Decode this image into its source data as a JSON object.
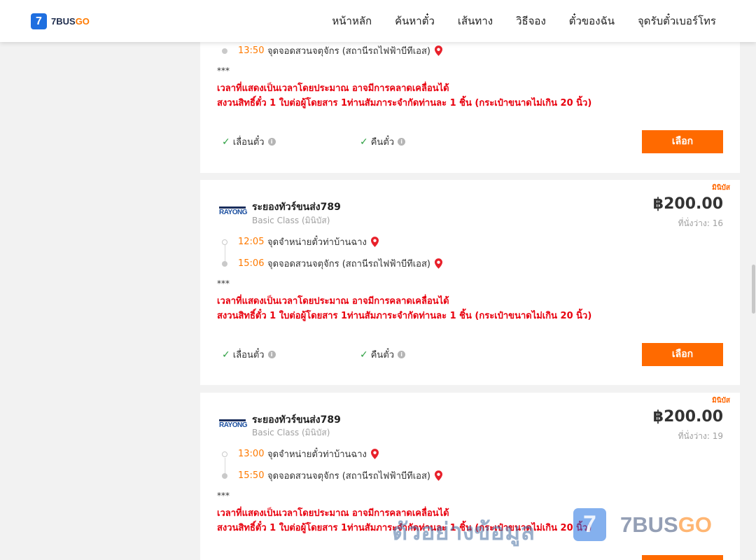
{
  "header": {
    "logo_mark": "7",
    "logo_text_a": "7BUS",
    "logo_text_b": "GO",
    "nav": [
      "หน้าหลัก",
      "ค้นหาตั๋ว",
      "เส้นทาง",
      "วิธีจอง",
      "ตั๋วของฉัน",
      "จุดรับตั๋วเบอร์โทร"
    ]
  },
  "colors": {
    "accent": "#ff6a00",
    "time": "#ff7a00",
    "warning": "#e8000e",
    "brand_blue": "#1f6fe0"
  },
  "icons": {
    "pin": "map-pin-icon",
    "check": "check-icon",
    "info": "info-icon"
  },
  "card0": {
    "arrive_time": "13:50",
    "arrive_place": "จุดจอดสวนจตุจักร (สถานีรถไฟฟ้าบีทีเอส)",
    "stars": "***",
    "note1": "เวลาที่แสดงเป็นเวลาโดยประมาณ อาจมีการคลาดเคลื่อนได้",
    "note2": "สงวนสิทธิ์ตั๋ว 1 ใบต่อผู้โดยสาร 1ท่านสัมภาระจำกัดท่านละ 1 ชิ้น (กระเป๋าขนาดไม่เกิน 20 นิ้ว)",
    "opt_reschedule": "เลื่อนตั๋ว",
    "opt_refund": "คืนตั๋ว",
    "select": "เลือก"
  },
  "card1": {
    "badge": "มินิบัส",
    "operator_logo": "RAYONG",
    "operator": "ระยองทัวร์ขนส่ง789",
    "class": "Basic Class (มินิบัส)",
    "price": "฿200.00",
    "seats": "ที่นั่งว่าง: 16",
    "depart_time": "12:05",
    "depart_place": "จุดจำหน่ายตั๋วท่าบ้านฉาง",
    "arrive_time": "15:06",
    "arrive_place": "จุดจอดสวนจตุจักร (สถานีรถไฟฟ้าบีทีเอส)",
    "stars": "***",
    "note1": "เวลาที่แสดงเป็นเวลาโดยประมาณ อาจมีการคลาดเคลื่อนได้",
    "note2": "สงวนสิทธิ์ตั๋ว 1 ใบต่อผู้โดยสาร 1ท่านสัมภาระจำกัดท่านละ 1 ชิ้น (กระเป๋าขนาดไม่เกิน 20 นิ้ว)",
    "opt_reschedule": "เลื่อนตั๋ว",
    "opt_refund": "คืนตั๋ว",
    "select": "เลือก"
  },
  "card2": {
    "badge": "มินิบัส",
    "operator_logo": "RAYONG",
    "operator": "ระยองทัวร์ขนส่ง789",
    "class": "Basic Class (มินิบัส)",
    "price": "฿200.00",
    "seats": "ที่นั่งว่าง: 19",
    "depart_time": "13:00",
    "depart_place": "จุดจำหน่ายตั๋วท่าบ้านฉาง",
    "arrive_time": "15:50",
    "arrive_place": "จุดจอดสวนจตุจักร (สถานีรถไฟฟ้าบีทีเอส)",
    "stars": "***",
    "note1": "เวลาที่แสดงเป็นเวลาโดยประมาณ อาจมีการคลาดเคลื่อนได้",
    "note2": "สงวนสิทธิ์ตั๋ว 1 ใบต่อผู้โดยสาร 1ท่านสัมภาระจำกัดท่านละ 1 ชิ้น (กระเป๋าขนาดไม่เกิน 20 นิ้ว)"
  },
  "watermark": {
    "text": "ตัวอย่างข้อมูล",
    "mark": "7",
    "brand_a": "7BUS",
    "brand_b": "GO"
  }
}
